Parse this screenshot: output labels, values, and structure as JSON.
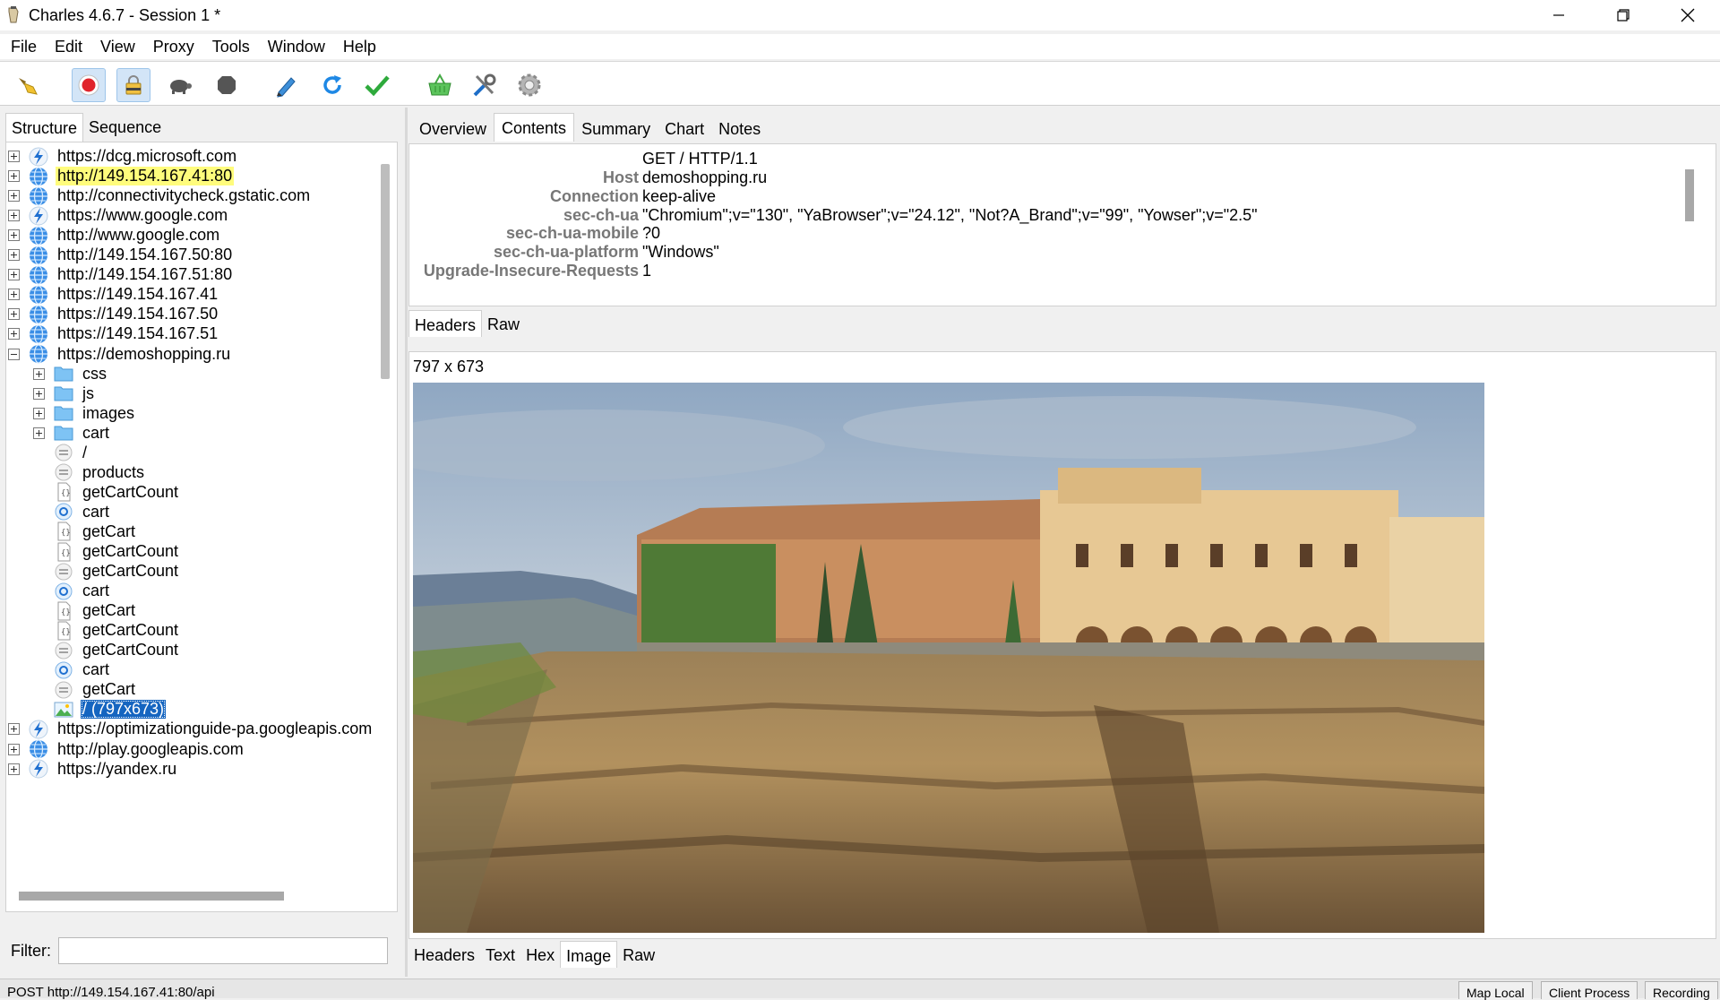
{
  "window": {
    "title": "Charles 4.6.7 - Session 1 *",
    "controls": [
      "minimize-icon",
      "restore-icon",
      "close-icon"
    ]
  },
  "menu": [
    "File",
    "Edit",
    "View",
    "Proxy",
    "Tools",
    "Window",
    "Help"
  ],
  "toolbar": {
    "buttons": [
      "broom-icon",
      "record-icon",
      "ssl-proxy-icon",
      "throttle-turtle-icon",
      "breakpoint-stop-icon",
      "compose-pen-icon",
      "repeat-icon",
      "validate-check-icon",
      "basket-icon",
      "tools-icon",
      "settings-gear-icon"
    ]
  },
  "left_tabs": [
    "Structure",
    "Sequence"
  ],
  "tree": [
    {
      "label": "https://dcg.microsoft.com",
      "icon": "lightning-icon",
      "expander": "plus"
    },
    {
      "label": "http://149.154.167.41:80",
      "icon": "globe-icon",
      "expander": "plus",
      "highlight": true
    },
    {
      "label": "http://connectivitycheck.gstatic.com",
      "icon": "globe-icon",
      "expander": "plus"
    },
    {
      "label": "https://www.google.com",
      "icon": "lightning-icon",
      "expander": "plus"
    },
    {
      "label": "http://www.google.com",
      "icon": "globe-icon",
      "expander": "plus"
    },
    {
      "label": "http://149.154.167.50:80",
      "icon": "globe-icon",
      "expander": "plus"
    },
    {
      "label": "http://149.154.167.51:80",
      "icon": "globe-icon",
      "expander": "plus"
    },
    {
      "label": "https://149.154.167.41",
      "icon": "globe-icon",
      "expander": "plus"
    },
    {
      "label": "https://149.154.167.50",
      "icon": "globe-icon",
      "expander": "plus"
    },
    {
      "label": "https://149.154.167.51",
      "icon": "globe-icon",
      "expander": "plus"
    },
    {
      "label": "https://demoshopping.ru",
      "icon": "globe-icon",
      "expander": "minus"
    },
    {
      "label": "css",
      "icon": "folder-icon",
      "expander": "plus",
      "child": true
    },
    {
      "label": "js",
      "icon": "folder-icon",
      "expander": "plus",
      "child": true
    },
    {
      "label": "images",
      "icon": "folder-icon",
      "expander": "plus",
      "child": true
    },
    {
      "label": "cart",
      "icon": "folder-icon",
      "expander": "plus",
      "child": true
    },
    {
      "label": "/",
      "icon": "blank-file-icon",
      "child": true
    },
    {
      "label": "products",
      "icon": "blank-file-icon",
      "child": true
    },
    {
      "label": "getCartCount",
      "icon": "json-file-icon",
      "child": true
    },
    {
      "label": "cart",
      "icon": "script-file-icon",
      "child": true
    },
    {
      "label": "getCart",
      "icon": "json-file-icon",
      "child": true
    },
    {
      "label": "getCartCount",
      "icon": "json-file-icon",
      "child": true
    },
    {
      "label": "getCartCount",
      "icon": "blank-file-icon",
      "child": true
    },
    {
      "label": "cart",
      "icon": "script-file-icon",
      "child": true
    },
    {
      "label": "getCart",
      "icon": "json-file-icon",
      "child": true
    },
    {
      "label": "getCartCount",
      "icon": "json-file-icon",
      "child": true
    },
    {
      "label": "getCartCount",
      "icon": "blank-file-icon",
      "child": true
    },
    {
      "label": "cart",
      "icon": "script-file-icon",
      "child": true
    },
    {
      "label": "getCart",
      "icon": "blank-file-icon",
      "child": true
    },
    {
      "label": "/ (797x673)",
      "icon": "image-file-icon",
      "child": true,
      "selected": true
    },
    {
      "label": "https://optimizationguide-pa.googleapis.com",
      "icon": "lightning-icon",
      "expander": "plus"
    },
    {
      "label": "http://play.googleapis.com",
      "icon": "globe-icon",
      "expander": "plus"
    },
    {
      "label": "https://yandex.ru",
      "icon": "lightning-icon",
      "expander": "plus"
    }
  ],
  "filter": {
    "label": "Filter:",
    "value": ""
  },
  "right_tabs": [
    "Overview",
    "Contents",
    "Summary",
    "Chart",
    "Notes"
  ],
  "request": {
    "request_line": "GET / HTTP/1.1",
    "headers": [
      {
        "key": "Host",
        "value": "demoshopping.ru"
      },
      {
        "key": "Connection",
        "value": "keep-alive"
      },
      {
        "key": "sec-ch-ua",
        "value": "\"Chromium\";v=\"130\", \"YaBrowser\";v=\"24.12\", \"Not?A_Brand\";v=\"99\", \"Yowser\";v=\"2.5\""
      },
      {
        "key": "sec-ch-ua-mobile",
        "value": "?0"
      },
      {
        "key": "sec-ch-ua-platform",
        "value": "\"Windows\""
      },
      {
        "key": "Upgrade-Insecure-Requests",
        "value": "1"
      }
    ],
    "tabs": [
      "Headers",
      "Raw"
    ]
  },
  "response": {
    "image_size": "797 x 673",
    "tabs": [
      "Headers",
      "Text",
      "Hex",
      "Image",
      "Raw"
    ]
  },
  "status": {
    "text": "POST http://149.154.167.41:80/api",
    "buttons": [
      "Map Local",
      "Client Process",
      "Recording"
    ]
  }
}
